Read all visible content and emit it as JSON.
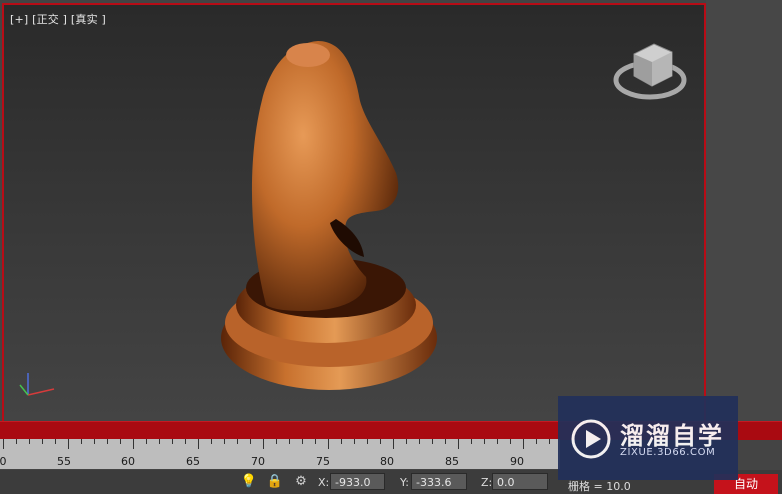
{
  "viewport": {
    "label": "[+] [正交 ] [真实 ]",
    "object": "knight-chess-piece",
    "accent_color": "#b80c16"
  },
  "timeline": {
    "tick_labels": [
      "0",
      "55",
      "60",
      "65",
      "70",
      "75",
      "80",
      "85",
      "90"
    ]
  },
  "statusbar": {
    "x_label": "X:",
    "x_value": "-933.0",
    "y_label": "Y:",
    "y_value": "-333.6",
    "z_label": "Z:",
    "z_value": "0.0",
    "grid_text": "栅格 = 10.0",
    "auto_key_label": "自动",
    "icons": [
      "lightbulb-icon",
      "lock-icon",
      "selection-mode-icon"
    ]
  },
  "watermark": {
    "title": "溜溜自学",
    "url": "ZIXUE.3D66.COM"
  }
}
